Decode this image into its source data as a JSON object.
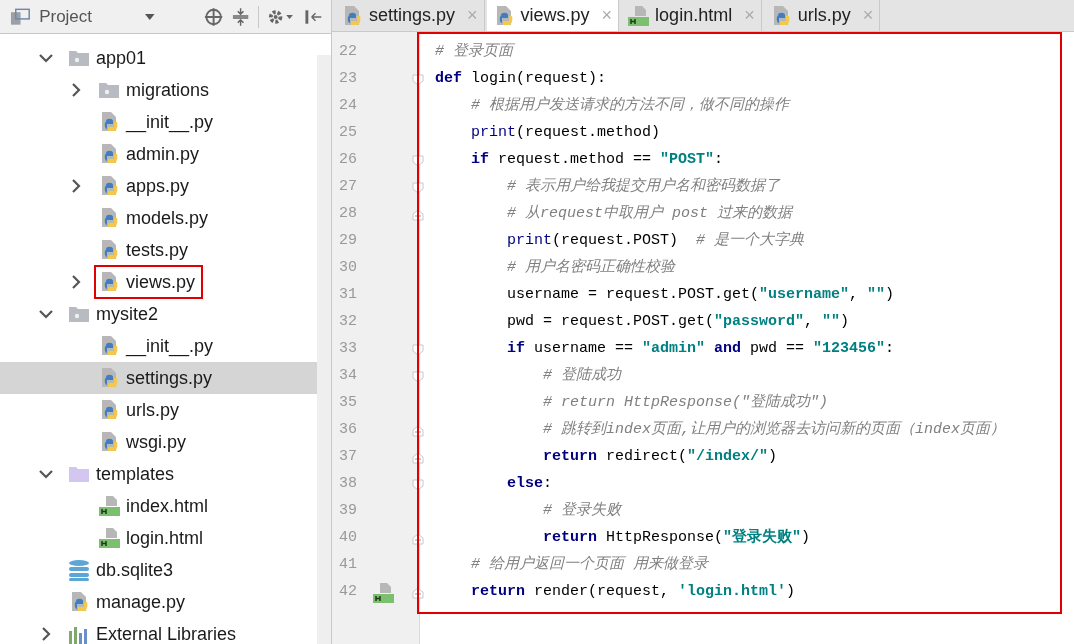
{
  "project_panel": {
    "title": "Project",
    "tree": [
      {
        "label": "app01",
        "kind": "package",
        "expanded": true,
        "selected": false,
        "children": [
          {
            "label": "migrations",
            "kind": "package",
            "expanded": false,
            "selected": false
          },
          {
            "label": "__init__.py",
            "kind": "py",
            "selected": false
          },
          {
            "label": "admin.py",
            "kind": "py",
            "selected": false
          },
          {
            "label": "apps.py",
            "kind": "py",
            "expanded": false,
            "selected": false
          },
          {
            "label": "models.py",
            "kind": "py",
            "selected": false
          },
          {
            "label": "tests.py",
            "kind": "py",
            "selected": false
          },
          {
            "label": "views.py",
            "kind": "py",
            "expanded": false,
            "selected": false,
            "highlighted": true
          }
        ]
      },
      {
        "label": "mysite2",
        "kind": "package",
        "expanded": true,
        "selected": false,
        "children": [
          {
            "label": "__init__.py",
            "kind": "py",
            "selected": false
          },
          {
            "label": "settings.py",
            "kind": "py",
            "selected": true
          },
          {
            "label": "urls.py",
            "kind": "py",
            "selected": false
          },
          {
            "label": "wsgi.py",
            "kind": "py",
            "selected": false
          }
        ]
      },
      {
        "label": "templates",
        "kind": "templates",
        "expanded": true,
        "selected": false,
        "children": [
          {
            "label": "index.html",
            "kind": "html",
            "selected": false
          },
          {
            "label": "login.html",
            "kind": "html",
            "selected": false
          }
        ]
      },
      {
        "label": "db.sqlite3",
        "kind": "db",
        "selected": false
      },
      {
        "label": "manage.py",
        "kind": "py",
        "selected": false
      },
      {
        "label": "External Libraries",
        "kind": "libs",
        "expanded": false,
        "selected": false
      }
    ]
  },
  "tabs": [
    {
      "label": "settings.py",
      "kind": "py",
      "selected": false,
      "close": "×"
    },
    {
      "label": "views.py",
      "kind": "py",
      "selected": true,
      "close": "×"
    },
    {
      "label": "login.html",
      "kind": "html",
      "selected": false,
      "close": "×"
    },
    {
      "label": "urls.py",
      "kind": "py",
      "selected": false,
      "close": "×"
    }
  ],
  "editor": {
    "highlighted": true,
    "lines": [
      {
        "number": "22",
        "kind": "plain",
        "tokens": [
          {
            "kind": "cmt",
            "text": "# 登录页面"
          }
        ]
      },
      {
        "number": "23",
        "kind": "fold-start",
        "tokens": [
          {
            "kind": "kw",
            "text": "def"
          },
          {
            "kind": "txt",
            "text": " login(request):"
          }
        ]
      },
      {
        "number": "24",
        "kind": "plain",
        "tokens": [
          {
            "kind": "cmt",
            "text": "    # 根据用户发送请求的方法不同，做不同的操作"
          }
        ]
      },
      {
        "number": "25",
        "kind": "plain",
        "tokens": [
          {
            "kind": "fn",
            "text": "    print"
          },
          {
            "kind": "txt",
            "text": "(request.method)"
          }
        ]
      },
      {
        "number": "26",
        "kind": "fold-start",
        "tokens": [
          {
            "kind": "kw",
            "text": "    if"
          },
          {
            "kind": "txt",
            "text": " request.method == "
          },
          {
            "kind": "str",
            "text": "\"POST\""
          },
          {
            "kind": "txt",
            "text": ":"
          }
        ]
      },
      {
        "number": "27",
        "kind": "fold-start",
        "tokens": [
          {
            "kind": "cmt",
            "text": "        # 表示用户给我提交用户名和密码数据了"
          }
        ]
      },
      {
        "number": "28",
        "kind": "fold-end",
        "tokens": [
          {
            "kind": "cmt",
            "text": "        # 从request中取用户 post 过来的数据"
          }
        ]
      },
      {
        "number": "29",
        "kind": "plain",
        "tokens": [
          {
            "kind": "fn",
            "text": "        print"
          },
          {
            "kind": "txt",
            "text": "(request.POST)  "
          },
          {
            "kind": "cmt",
            "text": "# 是一个大字典"
          }
        ]
      },
      {
        "number": "30",
        "kind": "plain",
        "tokens": [
          {
            "kind": "cmt",
            "text": "        # 用户名密码正确性校验"
          }
        ]
      },
      {
        "number": "31",
        "kind": "plain",
        "tokens": [
          {
            "kind": "txt",
            "text": "        username = request.POST.get("
          },
          {
            "kind": "str",
            "text": "\"username\""
          },
          {
            "kind": "txt",
            "text": ", "
          },
          {
            "kind": "str",
            "text": "\"\""
          },
          {
            "kind": "txt",
            "text": ")"
          }
        ]
      },
      {
        "number": "32",
        "kind": "plain",
        "tokens": [
          {
            "kind": "txt",
            "text": "        pwd = request.POST.get("
          },
          {
            "kind": "str",
            "text": "\"password\""
          },
          {
            "kind": "txt",
            "text": ", "
          },
          {
            "kind": "str",
            "text": "\"\""
          },
          {
            "kind": "txt",
            "text": ")"
          }
        ]
      },
      {
        "number": "33",
        "kind": "fold-start",
        "tokens": [
          {
            "kind": "kw",
            "text": "        if"
          },
          {
            "kind": "txt",
            "text": " username == "
          },
          {
            "kind": "str",
            "text": "\"admin\""
          },
          {
            "kind": "kw",
            "text": " and"
          },
          {
            "kind": "txt",
            "text": " pwd == "
          },
          {
            "kind": "str",
            "text": "\"123456\""
          },
          {
            "kind": "txt",
            "text": ":"
          }
        ]
      },
      {
        "number": "34",
        "kind": "fold-start",
        "tokens": [
          {
            "kind": "cmt",
            "text": "            # 登陆成功"
          }
        ]
      },
      {
        "number": "35",
        "kind": "plain",
        "tokens": [
          {
            "kind": "cmt",
            "text": "            # return HttpResponse(\"登陆成功\")"
          }
        ]
      },
      {
        "number": "36",
        "kind": "fold-end",
        "tokens": [
          {
            "kind": "cmt",
            "text": "            # 跳转到index页面,让用户的浏览器去访问新的页面（index页面）"
          }
        ]
      },
      {
        "number": "37",
        "kind": "fold-end",
        "tokens": [
          {
            "kind": "kw",
            "text": "            return"
          },
          {
            "kind": "txt",
            "text": " redirect("
          },
          {
            "kind": "str",
            "text": "\"/index/\""
          },
          {
            "kind": "txt",
            "text": ")"
          }
        ]
      },
      {
        "number": "38",
        "kind": "fold-start",
        "tokens": [
          {
            "kind": "kw",
            "text": "        else"
          },
          {
            "kind": "txt",
            "text": ":"
          }
        ]
      },
      {
        "number": "39",
        "kind": "plain",
        "tokens": [
          {
            "kind": "cmt",
            "text": "            # 登录失败"
          }
        ]
      },
      {
        "number": "40",
        "kind": "fold-end",
        "tokens": [
          {
            "kind": "kw",
            "text": "            return"
          },
          {
            "kind": "txt",
            "text": " HttpResponse("
          },
          {
            "kind": "str",
            "text": "\"登录失败\""
          },
          {
            "kind": "txt",
            "text": ")"
          }
        ]
      },
      {
        "number": "41",
        "kind": "plain",
        "tokens": [
          {
            "kind": "cmt",
            "text": "    # 给用户返回一个页面 用来做登录"
          }
        ]
      },
      {
        "number": "42",
        "kind": "fold-end",
        "gutter_icon": {
          "kind": "html"
        },
        "tokens": [
          {
            "kind": "kw",
            "text": "    return"
          },
          {
            "kind": "txt",
            "text": " render(request, "
          },
          {
            "kind": "str",
            "text": "'login.html'"
          },
          {
            "kind": "txt",
            "text": ")"
          }
        ]
      }
    ]
  }
}
